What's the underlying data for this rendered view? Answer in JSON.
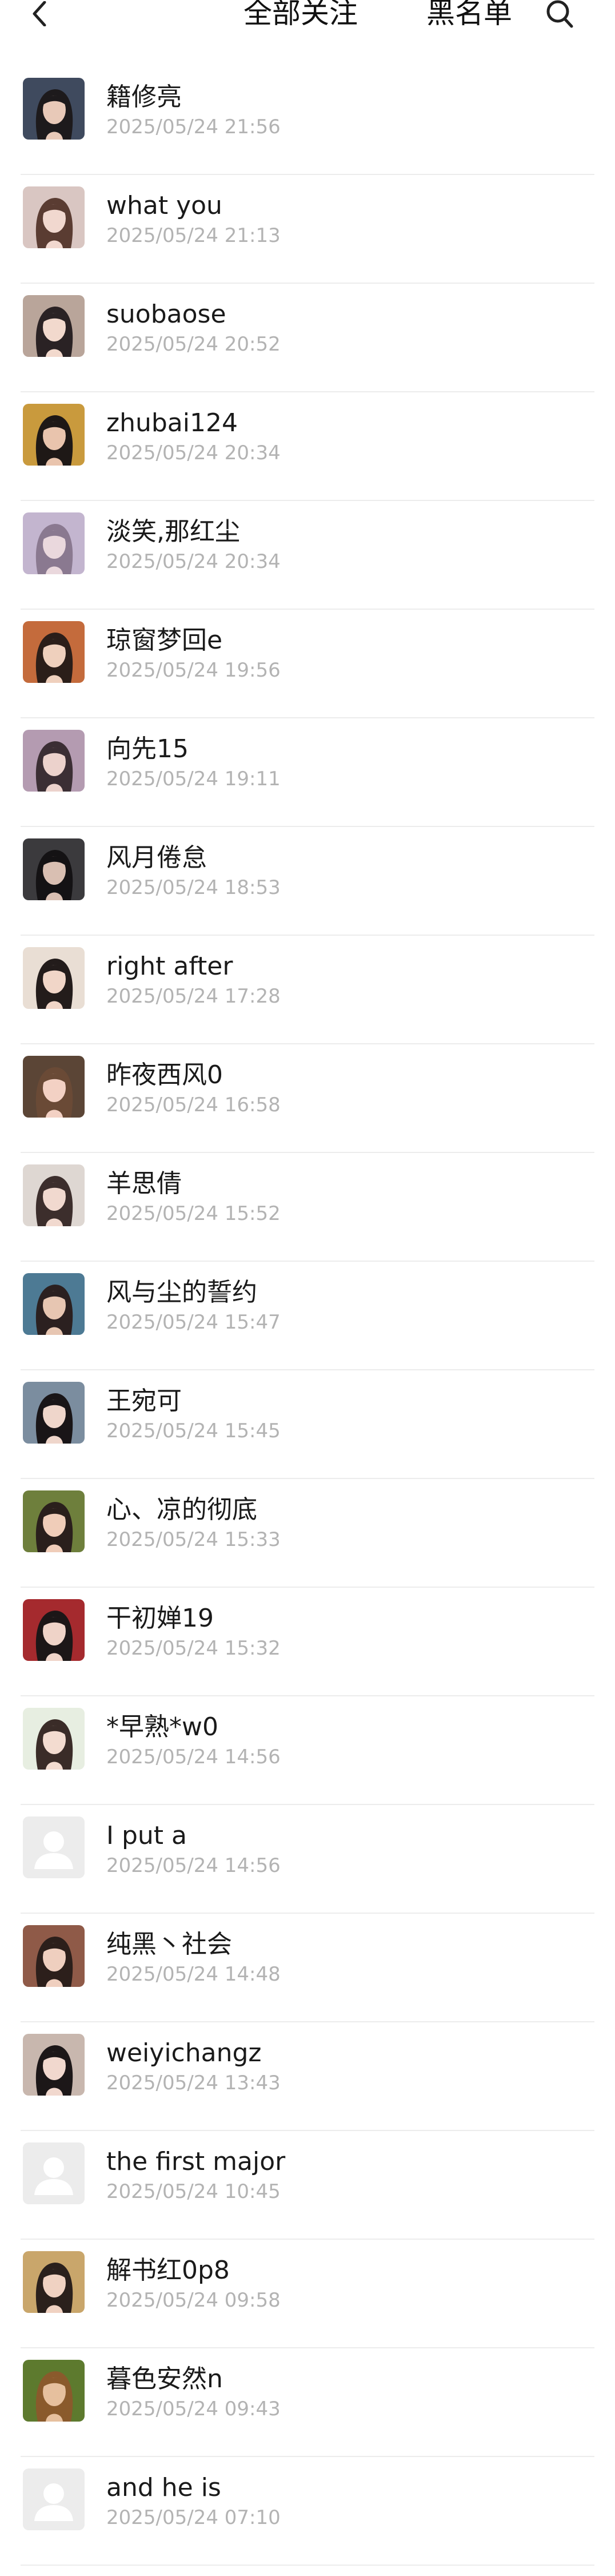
{
  "header": {
    "back_icon": "chevron-left-icon",
    "tab_all": "全部关注",
    "tab_blacklist": "黑名单",
    "search_icon": "search-icon"
  },
  "follows": [
    {
      "name": "籍修亮",
      "time": "2025/05/24 21:56",
      "avatar": "photo",
      "bg": "#3f4a5e",
      "skin": "#e8c9b8",
      "hair": "#1d1a1c"
    },
    {
      "name": "what you",
      "time": "2025/05/24 21:13",
      "avatar": "photo",
      "bg": "#d9c6c2",
      "skin": "#f1d8cf",
      "hair": "#5a3c32"
    },
    {
      "name": "suobaose",
      "time": "2025/05/24 20:52",
      "avatar": "photo",
      "bg": "#b9a59a",
      "skin": "#f2d9cd",
      "hair": "#2a2224"
    },
    {
      "name": "zhubai124",
      "time": "2025/05/24 20:34",
      "avatar": "photo",
      "bg": "#c99a3d",
      "skin": "#e9c4ad",
      "hair": "#1e1816"
    },
    {
      "name": "淡笑,那红尘",
      "time": "2025/05/24 20:34",
      "avatar": "photo",
      "bg": "#c3b5cf",
      "skin": "#ead8dd",
      "hair": "#8a7990"
    },
    {
      "name": "琼窗梦回e",
      "time": "2025/05/24 19:56",
      "avatar": "photo",
      "bg": "#c46b3c",
      "skin": "#efd0bd",
      "hair": "#2b1e19"
    },
    {
      "name": "向先15",
      "time": "2025/05/24 19:11",
      "avatar": "photo",
      "bg": "#b49bb1",
      "skin": "#ecd2cc",
      "hair": "#3b2e34"
    },
    {
      "name": "风月倦怠",
      "time": "2025/05/24 18:53",
      "avatar": "photo",
      "bg": "#3b3a3d",
      "skin": "#d9bfb2",
      "hair": "#141214"
    },
    {
      "name": "right after",
      "time": "2025/05/24 17:28",
      "avatar": "photo",
      "bg": "#e9ded4",
      "skin": "#f1d6c8",
      "hair": "#231c1b"
    },
    {
      "name": "昨夜西风0",
      "time": "2025/05/24 16:58",
      "avatar": "photo",
      "bg": "#5b4536",
      "skin": "#f3d1c4",
      "hair": "#6a4a36"
    },
    {
      "name": "羊思倩",
      "time": "2025/05/24 15:52",
      "avatar": "photo",
      "bg": "#ded7d2",
      "skin": "#f1d9cf",
      "hair": "#3c2e2c"
    },
    {
      "name": "风与尘的誓约",
      "time": "2025/05/24 15:47",
      "avatar": "photo",
      "bg": "#4d7a94",
      "skin": "#e7c6b2",
      "hair": "#2b2020"
    },
    {
      "name": "王宛可",
      "time": "2025/05/24 15:45",
      "avatar": "photo",
      "bg": "#7b8d9f",
      "skin": "#efd6cb",
      "hair": "#191517"
    },
    {
      "name": "心、凉的彻底",
      "time": "2025/05/24 15:33",
      "avatar": "photo",
      "bg": "#6e7f3c",
      "skin": "#f0cdb9",
      "hair": "#2a1f1c"
    },
    {
      "name": "干初婵19",
      "time": "2025/05/24 15:32",
      "avatar": "photo",
      "bg": "#a52a2e",
      "skin": "#efd3c8",
      "hair": "#1c1617"
    },
    {
      "name": "*早熟*w0",
      "time": "2025/05/24 14:56",
      "avatar": "photo",
      "bg": "#e7eee1",
      "skin": "#f3dcd0",
      "hair": "#3a2c28"
    },
    {
      "name": "I put a",
      "time": "2025/05/24 14:56",
      "avatar": "placeholder"
    },
    {
      "name": "纯黑丶社会",
      "time": "2025/05/24 14:48",
      "avatar": "photo",
      "bg": "#8f5a48",
      "skin": "#efcfbf",
      "hair": "#2c1f1b"
    },
    {
      "name": "weiyichangz",
      "time": "2025/05/24 13:43",
      "avatar": "photo",
      "bg": "#c8b7ae",
      "skin": "#f1d8ce",
      "hair": "#1c1718"
    },
    {
      "name": "the first major",
      "time": "2025/05/24 10:45",
      "avatar": "placeholder"
    },
    {
      "name": "解书红0p8",
      "time": "2025/05/24 09:58",
      "avatar": "photo",
      "bg": "#c9a66b",
      "skin": "#f0d2c2",
      "hair": "#2a201c"
    },
    {
      "name": "暮色安然n",
      "time": "2025/05/24 09:43",
      "avatar": "photo",
      "bg": "#5d7a2e",
      "skin": "#e6c09e",
      "hair": "#8a5a2c"
    },
    {
      "name": "and he is",
      "time": "2025/05/24 07:10",
      "avatar": "placeholder"
    }
  ]
}
